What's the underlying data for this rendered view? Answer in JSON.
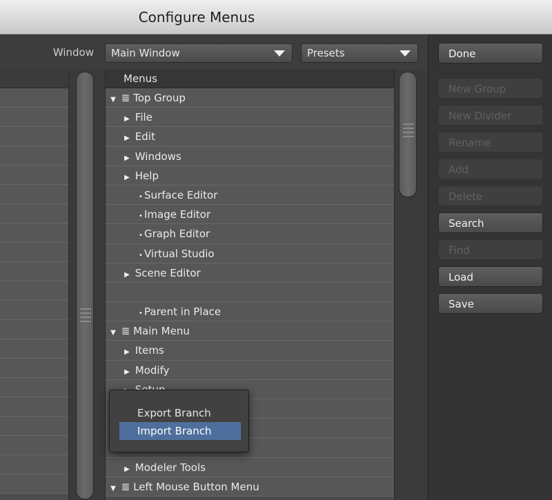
{
  "window": {
    "title": "Configure Menus"
  },
  "toolbar": {
    "window_label": "Window",
    "window_select": "Main Window",
    "presets_select": "Presets"
  },
  "menus": {
    "header": "Menus",
    "rows": [
      {
        "indent": 0,
        "marker": "twisty-open",
        "icon": true,
        "label": "Top Group"
      },
      {
        "indent": 1,
        "marker": "arrow",
        "label": "File"
      },
      {
        "indent": 1,
        "marker": "arrow",
        "label": "Edit"
      },
      {
        "indent": 1,
        "marker": "arrow",
        "label": "Windows"
      },
      {
        "indent": 1,
        "marker": "arrow",
        "label": "Help"
      },
      {
        "indent": 2,
        "marker": "bullet",
        "label": "Surface Editor"
      },
      {
        "indent": 2,
        "marker": "bullet",
        "label": "Image Editor"
      },
      {
        "indent": 2,
        "marker": "bullet",
        "label": "Graph Editor"
      },
      {
        "indent": 2,
        "marker": "bullet",
        "label": "Virtual Studio"
      },
      {
        "indent": 1,
        "marker": "arrow",
        "label": "Scene Editor"
      },
      {
        "indent": 1,
        "marker": "none",
        "label": ""
      },
      {
        "indent": 2,
        "marker": "bullet",
        "label": "Parent in Place"
      },
      {
        "indent": 0,
        "marker": "twisty-open",
        "icon": true,
        "label": "Main Menu"
      },
      {
        "indent": 1,
        "marker": "arrow",
        "label": "Items"
      },
      {
        "indent": 1,
        "marker": "arrow",
        "label": "Modify"
      },
      {
        "indent": 1,
        "marker": "arrow",
        "label": "Setup"
      },
      {
        "indent": 1,
        "marker": "none",
        "label": ""
      },
      {
        "indent": 1,
        "marker": "none",
        "label": ""
      },
      {
        "indent": 1,
        "marker": "none",
        "label": ""
      },
      {
        "indent": 1,
        "marker": "arrow",
        "label": "Modeler Tools"
      },
      {
        "indent": 0,
        "marker": "twisty-open",
        "icon": true,
        "label": "Left Mouse Button Menu"
      }
    ]
  },
  "buttons": [
    {
      "label": "Done",
      "enabled": true
    },
    {
      "label": "New Group",
      "enabled": false
    },
    {
      "label": "New Divider",
      "enabled": false
    },
    {
      "label": "Rename",
      "enabled": false
    },
    {
      "label": "Add",
      "enabled": false
    },
    {
      "label": "Delete",
      "enabled": false
    },
    {
      "label": "Search",
      "enabled": true
    },
    {
      "label": "Find",
      "enabled": false
    },
    {
      "label": "Load",
      "enabled": true
    },
    {
      "label": "Save",
      "enabled": true
    }
  ],
  "context_menu": {
    "items": [
      {
        "label": "Export Branch",
        "highlighted": false
      },
      {
        "label": "Import Branch",
        "highlighted": true
      }
    ]
  }
}
